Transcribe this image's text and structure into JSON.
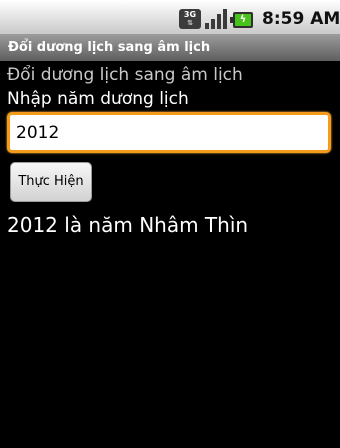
{
  "status_bar": {
    "network_type": "3G",
    "network_icon": "3g-data-icon",
    "signal_icon": "signal-strength-icon",
    "battery_icon": "battery-charging-icon",
    "time": "8:59 AM"
  },
  "app": {
    "title": "Đổi dương lịch sang âm lịch"
  },
  "main": {
    "heading": "Đổi dương lịch sang âm lịch",
    "input_label": "Nhập năm dương lịch",
    "year_value": "2012",
    "button_label": "Thực Hiện",
    "result_text": "2012 là năm Nhâm Thìn"
  },
  "colors": {
    "focus_border": "#f59b1b",
    "battery_green": "#46c21a"
  }
}
